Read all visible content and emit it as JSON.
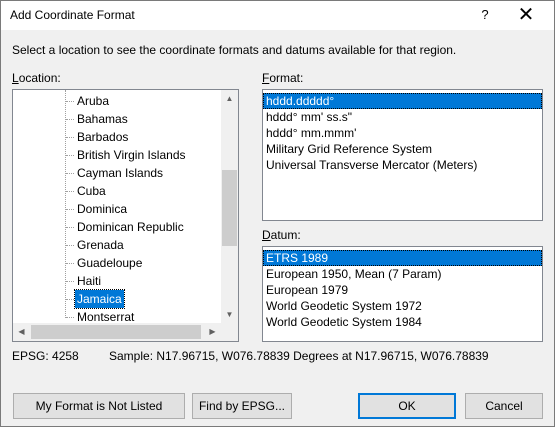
{
  "window": {
    "title": "Add Coordinate Format",
    "help": "?",
    "close": "✕"
  },
  "instruction": "Select a location to see the coordinate formats and datums available for that region.",
  "location": {
    "label_mnemonic": "L",
    "label_rest": "ocation:",
    "items": [
      "Aruba",
      "Bahamas",
      "Barbados",
      "British Virgin Islands",
      "Cayman Islands",
      "Cuba",
      "Dominica",
      "Dominican Republic",
      "Grenada",
      "Guadeloupe",
      "Haiti",
      "Jamaica",
      "Montserrat"
    ],
    "selected_index": 11
  },
  "format": {
    "label_mnemonic": "F",
    "label_rest": "ormat:",
    "items": [
      "hddd.ddddd°",
      "hddd° mm' ss.s\"",
      "hddd° mm.mmm'",
      "Military Grid Reference System",
      "Universal Transverse Mercator (Meters)"
    ],
    "selected_index": 0
  },
  "datum": {
    "label_mnemonic": "D",
    "label_rest": "atum:",
    "items": [
      "ETRS 1989",
      "European 1950, Mean (7 Param)",
      "European 1979",
      "World Geodetic System 1972",
      "World Geodetic System 1984"
    ],
    "selected_index": 0
  },
  "status": {
    "epsg": "EPSG: 4258",
    "sample": "Sample: N17.96715, W076.78839 Degrees at N17.96715, W076.78839"
  },
  "buttons": {
    "not_listed": "My Format is Not Listed",
    "find_epsg": "Find by EPSG...",
    "ok": "OK",
    "cancel": "Cancel"
  },
  "scroll_arrows": {
    "up": "▲",
    "down": "▼",
    "left": "◀",
    "right": "▶"
  }
}
